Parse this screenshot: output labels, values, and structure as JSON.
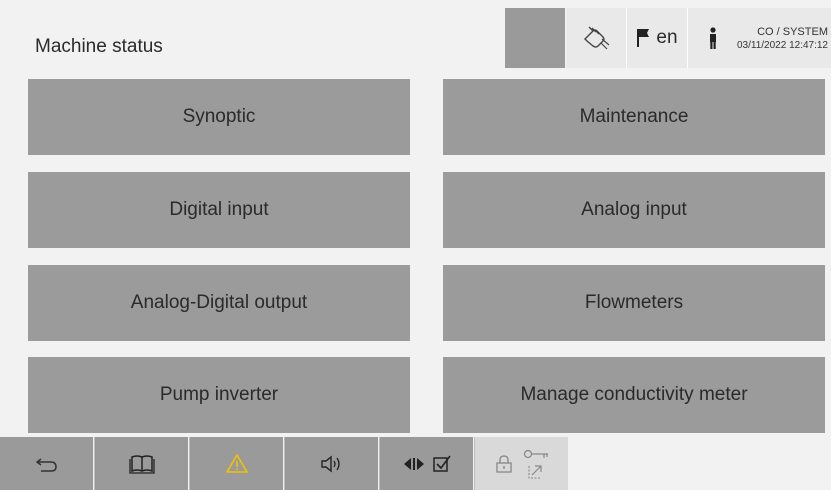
{
  "header": {
    "title": "Machine status",
    "language": "en",
    "user_role": "CO / SYSTEM",
    "datetime": "03/11/2022 12:47:12",
    "icons": [
      "hand-touch-icon",
      "flag-icon",
      "user-icon"
    ]
  },
  "menu": [
    {
      "label": "Synoptic"
    },
    {
      "label": "Maintenance"
    },
    {
      "label": "Digital input"
    },
    {
      "label": "Analog input"
    },
    {
      "label": "Analog-Digital output"
    },
    {
      "label": "Flowmeters"
    },
    {
      "label": "Pump inverter"
    },
    {
      "label": "Manage conductivity meter"
    }
  ],
  "footer": {
    "icons": [
      "back-icon",
      "manual-book-icon",
      "warning-icon",
      "speaker-icon",
      "play-pause-icon",
      "checkbox-icon",
      "lock-icon",
      "key-icon",
      "export-icon"
    ]
  },
  "colors": {
    "button_gray": "#9b9b9b",
    "background": "#f2f2f2",
    "warning_yellow": "#f2c200"
  }
}
